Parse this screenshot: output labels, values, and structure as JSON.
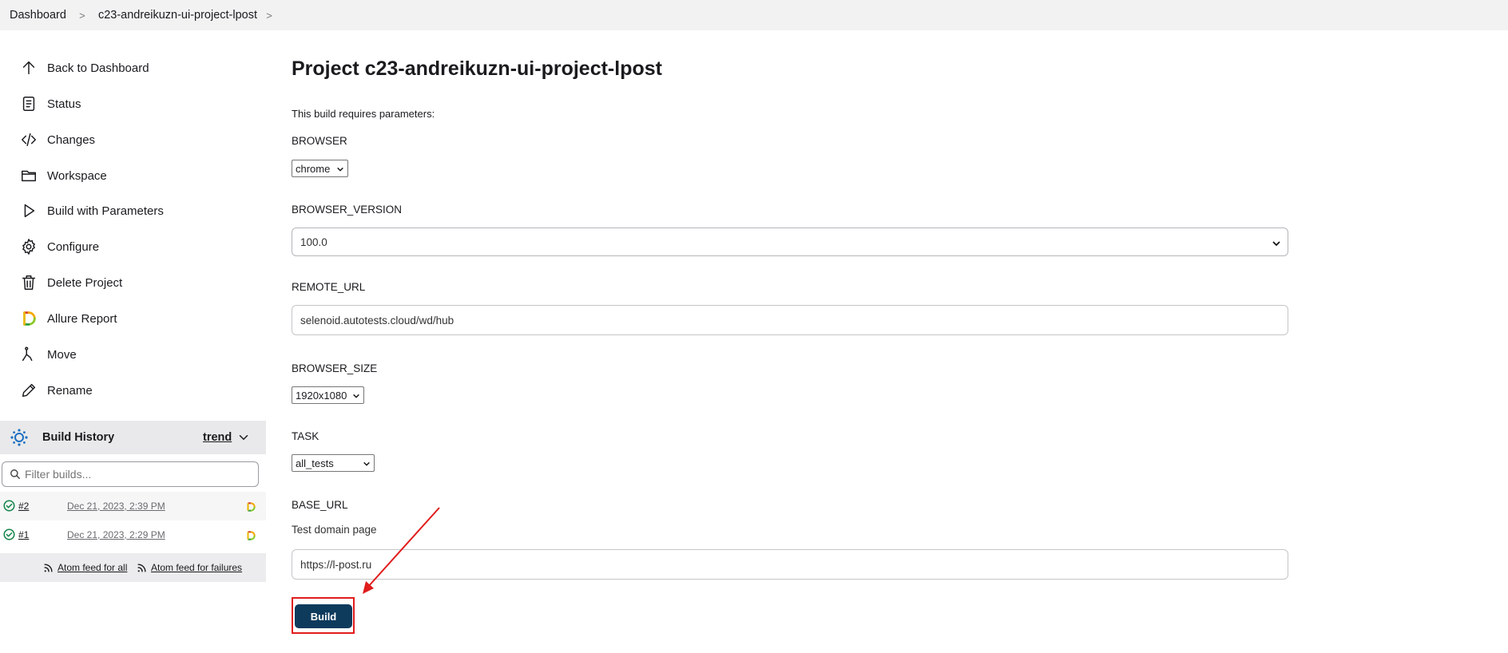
{
  "breadcrumb": {
    "items": [
      "Dashboard",
      "c23-andreikuzn-ui-project-lpost"
    ],
    "separator": ">"
  },
  "sidebar": {
    "items": [
      {
        "label": "Back to Dashboard",
        "icon": "arrow-up-icon"
      },
      {
        "label": "Status",
        "icon": "document-icon"
      },
      {
        "label": "Changes",
        "icon": "code-icon"
      },
      {
        "label": "Workspace",
        "icon": "folder-icon"
      },
      {
        "label": "Build with Parameters",
        "icon": "play-icon"
      },
      {
        "label": "Configure",
        "icon": "gear-icon"
      },
      {
        "label": "Delete Project",
        "icon": "trash-icon"
      },
      {
        "label": "Allure Report",
        "icon": "allure-icon"
      },
      {
        "label": "Move",
        "icon": "move-icon"
      },
      {
        "label": "Rename",
        "icon": "pencil-icon"
      }
    ]
  },
  "build_history": {
    "title": "Build History",
    "trend": "trend",
    "filter_placeholder": "Filter builds...",
    "builds": [
      {
        "number": "#2",
        "date": "Dec 21, 2023, 2:39 PM"
      },
      {
        "number": "#1",
        "date": "Dec 21, 2023, 2:29 PM"
      }
    ],
    "feed_all": "Atom feed for all",
    "feed_failures": "Atom feed for failures"
  },
  "main": {
    "title": "Project c23-andreikuzn-ui-project-lpost",
    "note": "This build requires parameters:",
    "params": {
      "browser": {
        "label": "BROWSER",
        "value": "chrome"
      },
      "browser_version": {
        "label": "BROWSER_VERSION",
        "value": "100.0"
      },
      "remote_url": {
        "label": "REMOTE_URL",
        "value": "selenoid.autotests.cloud/wd/hub"
      },
      "browser_size": {
        "label": "BROWSER_SIZE",
        "value": "1920x1080"
      },
      "task": {
        "label": "TASK",
        "value": "all_tests"
      },
      "base_url": {
        "label": "BASE_URL",
        "description": "Test domain page",
        "value": "https://l-post.ru"
      }
    },
    "build_label": "Build"
  },
  "colors": {
    "build_button": "#0e3a5c",
    "highlight": "#e01c1c",
    "success": "#138347"
  }
}
